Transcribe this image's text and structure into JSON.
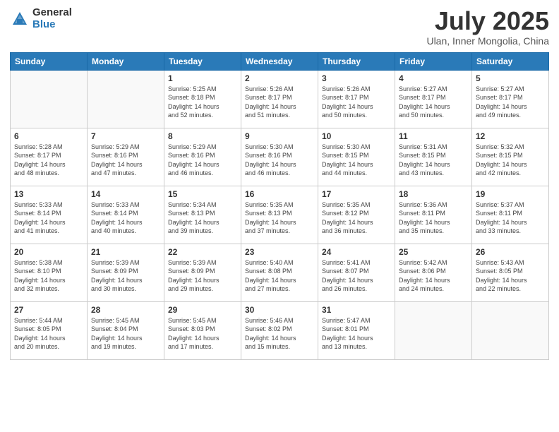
{
  "header": {
    "logo_general": "General",
    "logo_blue": "Blue",
    "month_title": "July 2025",
    "location": "Ulan, Inner Mongolia, China"
  },
  "days_of_week": [
    "Sunday",
    "Monday",
    "Tuesday",
    "Wednesday",
    "Thursday",
    "Friday",
    "Saturday"
  ],
  "weeks": [
    [
      {
        "day": "",
        "info": ""
      },
      {
        "day": "",
        "info": ""
      },
      {
        "day": "1",
        "info": "Sunrise: 5:25 AM\nSunset: 8:18 PM\nDaylight: 14 hours\nand 52 minutes."
      },
      {
        "day": "2",
        "info": "Sunrise: 5:26 AM\nSunset: 8:17 PM\nDaylight: 14 hours\nand 51 minutes."
      },
      {
        "day": "3",
        "info": "Sunrise: 5:26 AM\nSunset: 8:17 PM\nDaylight: 14 hours\nand 50 minutes."
      },
      {
        "day": "4",
        "info": "Sunrise: 5:27 AM\nSunset: 8:17 PM\nDaylight: 14 hours\nand 50 minutes."
      },
      {
        "day": "5",
        "info": "Sunrise: 5:27 AM\nSunset: 8:17 PM\nDaylight: 14 hours\nand 49 minutes."
      }
    ],
    [
      {
        "day": "6",
        "info": "Sunrise: 5:28 AM\nSunset: 8:17 PM\nDaylight: 14 hours\nand 48 minutes."
      },
      {
        "day": "7",
        "info": "Sunrise: 5:29 AM\nSunset: 8:16 PM\nDaylight: 14 hours\nand 47 minutes."
      },
      {
        "day": "8",
        "info": "Sunrise: 5:29 AM\nSunset: 8:16 PM\nDaylight: 14 hours\nand 46 minutes."
      },
      {
        "day": "9",
        "info": "Sunrise: 5:30 AM\nSunset: 8:16 PM\nDaylight: 14 hours\nand 46 minutes."
      },
      {
        "day": "10",
        "info": "Sunrise: 5:30 AM\nSunset: 8:15 PM\nDaylight: 14 hours\nand 44 minutes."
      },
      {
        "day": "11",
        "info": "Sunrise: 5:31 AM\nSunset: 8:15 PM\nDaylight: 14 hours\nand 43 minutes."
      },
      {
        "day": "12",
        "info": "Sunrise: 5:32 AM\nSunset: 8:15 PM\nDaylight: 14 hours\nand 42 minutes."
      }
    ],
    [
      {
        "day": "13",
        "info": "Sunrise: 5:33 AM\nSunset: 8:14 PM\nDaylight: 14 hours\nand 41 minutes."
      },
      {
        "day": "14",
        "info": "Sunrise: 5:33 AM\nSunset: 8:14 PM\nDaylight: 14 hours\nand 40 minutes."
      },
      {
        "day": "15",
        "info": "Sunrise: 5:34 AM\nSunset: 8:13 PM\nDaylight: 14 hours\nand 39 minutes."
      },
      {
        "day": "16",
        "info": "Sunrise: 5:35 AM\nSunset: 8:13 PM\nDaylight: 14 hours\nand 37 minutes."
      },
      {
        "day": "17",
        "info": "Sunrise: 5:35 AM\nSunset: 8:12 PM\nDaylight: 14 hours\nand 36 minutes."
      },
      {
        "day": "18",
        "info": "Sunrise: 5:36 AM\nSunset: 8:11 PM\nDaylight: 14 hours\nand 35 minutes."
      },
      {
        "day": "19",
        "info": "Sunrise: 5:37 AM\nSunset: 8:11 PM\nDaylight: 14 hours\nand 33 minutes."
      }
    ],
    [
      {
        "day": "20",
        "info": "Sunrise: 5:38 AM\nSunset: 8:10 PM\nDaylight: 14 hours\nand 32 minutes."
      },
      {
        "day": "21",
        "info": "Sunrise: 5:39 AM\nSunset: 8:09 PM\nDaylight: 14 hours\nand 30 minutes."
      },
      {
        "day": "22",
        "info": "Sunrise: 5:39 AM\nSunset: 8:09 PM\nDaylight: 14 hours\nand 29 minutes."
      },
      {
        "day": "23",
        "info": "Sunrise: 5:40 AM\nSunset: 8:08 PM\nDaylight: 14 hours\nand 27 minutes."
      },
      {
        "day": "24",
        "info": "Sunrise: 5:41 AM\nSunset: 8:07 PM\nDaylight: 14 hours\nand 26 minutes."
      },
      {
        "day": "25",
        "info": "Sunrise: 5:42 AM\nSunset: 8:06 PM\nDaylight: 14 hours\nand 24 minutes."
      },
      {
        "day": "26",
        "info": "Sunrise: 5:43 AM\nSunset: 8:05 PM\nDaylight: 14 hours\nand 22 minutes."
      }
    ],
    [
      {
        "day": "27",
        "info": "Sunrise: 5:44 AM\nSunset: 8:05 PM\nDaylight: 14 hours\nand 20 minutes."
      },
      {
        "day": "28",
        "info": "Sunrise: 5:45 AM\nSunset: 8:04 PM\nDaylight: 14 hours\nand 19 minutes."
      },
      {
        "day": "29",
        "info": "Sunrise: 5:45 AM\nSunset: 8:03 PM\nDaylight: 14 hours\nand 17 minutes."
      },
      {
        "day": "30",
        "info": "Sunrise: 5:46 AM\nSunset: 8:02 PM\nDaylight: 14 hours\nand 15 minutes."
      },
      {
        "day": "31",
        "info": "Sunrise: 5:47 AM\nSunset: 8:01 PM\nDaylight: 14 hours\nand 13 minutes."
      },
      {
        "day": "",
        "info": ""
      },
      {
        "day": "",
        "info": ""
      }
    ]
  ]
}
